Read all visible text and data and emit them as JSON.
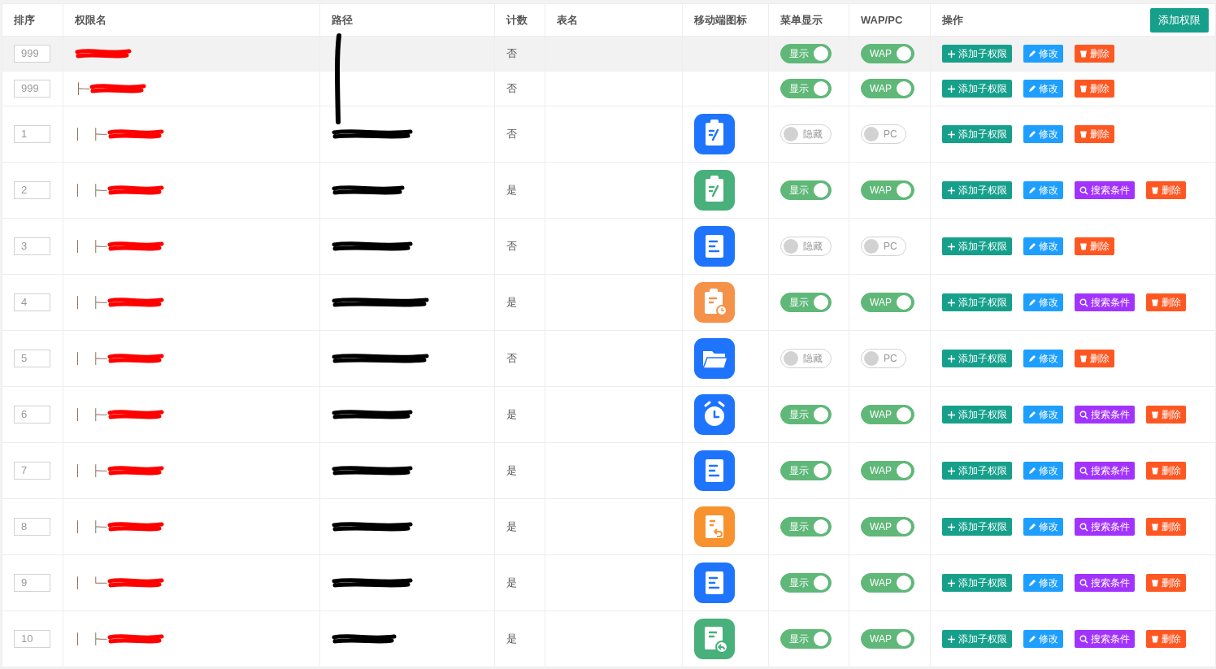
{
  "table": {
    "columns": [
      "排序",
      "权限名",
      "路径",
      "计数",
      "表名",
      "移动端图标",
      "菜单显示",
      "WAP/PC",
      "操作"
    ],
    "add_button": "添加权限",
    "rows": [
      {
        "sort": "999",
        "prefix": "",
        "highlighted": true,
        "name": {
          "kind": "redacted"
        },
        "count": "否",
        "icon": null,
        "menu": {
          "on": true,
          "label": "显示"
        },
        "platform": {
          "on": true,
          "label": "WAP"
        },
        "actions": [
          {
            "kind": "add",
            "label": "添加子权限"
          },
          {
            "kind": "edit",
            "label": "修改"
          },
          {
            "kind": "delete",
            "label": "删除"
          }
        ]
      },
      {
        "sort": "999",
        "prefix": "├─",
        "highlighted": false,
        "name": {
          "kind": "redacted"
        },
        "count": "否",
        "icon": null,
        "menu": {
          "on": true,
          "label": "显示"
        },
        "platform": {
          "on": true,
          "label": "WAP"
        },
        "actions": [
          {
            "kind": "add",
            "label": "添加子权限"
          },
          {
            "kind": "edit",
            "label": "修改"
          },
          {
            "kind": "delete",
            "label": "删除"
          }
        ]
      },
      {
        "sort": "1",
        "prefix": "│　├─",
        "highlighted": false,
        "name": {
          "kind": "redacted"
        },
        "path": {
          "kind": "redacted"
        },
        "count": "否",
        "icon": {
          "kind": "clipboard",
          "color": "#1e74fd"
        },
        "menu": {
          "on": false,
          "label": "隐藏"
        },
        "platform": {
          "on": false,
          "label": "PC"
        },
        "actions": [
          {
            "kind": "add",
            "label": "添加子权限"
          },
          {
            "kind": "edit",
            "label": "修改"
          },
          {
            "kind": "delete",
            "label": "删除"
          }
        ]
      },
      {
        "sort": "2",
        "prefix": "│　├─",
        "highlighted": false,
        "name": {
          "kind": "redacted"
        },
        "path": {
          "kind": "redacted"
        },
        "count": "是",
        "icon": {
          "kind": "clipboard",
          "color": "#48b07a"
        },
        "menu": {
          "on": true,
          "label": "显示"
        },
        "platform": {
          "on": true,
          "label": "WAP"
        },
        "actions": [
          {
            "kind": "add",
            "label": "添加子权限"
          },
          {
            "kind": "edit",
            "label": "修改"
          },
          {
            "kind": "search",
            "label": "搜索条件"
          },
          {
            "kind": "delete",
            "label": "删除"
          }
        ]
      },
      {
        "sort": "3",
        "prefix": "│　├─",
        "highlighted": false,
        "name": {
          "kind": "redacted"
        },
        "path": {
          "kind": "redacted"
        },
        "count": "否",
        "icon": {
          "kind": "document",
          "color": "#1e74fd"
        },
        "menu": {
          "on": false,
          "label": "隐藏"
        },
        "platform": {
          "on": false,
          "label": "PC"
        },
        "actions": [
          {
            "kind": "add",
            "label": "添加子权限"
          },
          {
            "kind": "edit",
            "label": "修改"
          },
          {
            "kind": "delete",
            "label": "删除"
          }
        ]
      },
      {
        "sort": "4",
        "prefix": "│　├─",
        "highlighted": false,
        "name": {
          "kind": "redacted"
        },
        "path": {
          "kind": "redacted"
        },
        "count": "是",
        "icon": {
          "kind": "clock-clipboard",
          "color": "#f5924a"
        },
        "menu": {
          "on": true,
          "label": "显示"
        },
        "platform": {
          "on": true,
          "label": "WAP"
        },
        "actions": [
          {
            "kind": "add",
            "label": "添加子权限"
          },
          {
            "kind": "edit",
            "label": "修改"
          },
          {
            "kind": "search",
            "label": "搜索条件"
          },
          {
            "kind": "delete",
            "label": "删除"
          }
        ]
      },
      {
        "sort": "5",
        "prefix": "│　├─",
        "highlighted": false,
        "name": {
          "kind": "redacted"
        },
        "path": {
          "kind": "redacted"
        },
        "count": "否",
        "icon": {
          "kind": "folder",
          "color": "#1e74fd"
        },
        "menu": {
          "on": false,
          "label": "隐藏"
        },
        "platform": {
          "on": false,
          "label": "PC"
        },
        "actions": [
          {
            "kind": "add",
            "label": "添加子权限"
          },
          {
            "kind": "edit",
            "label": "修改"
          },
          {
            "kind": "delete",
            "label": "删除"
          }
        ]
      },
      {
        "sort": "6",
        "prefix": "│　├─",
        "highlighted": false,
        "name": {
          "kind": "redacted"
        },
        "path": {
          "kind": "redacted"
        },
        "count": "是",
        "icon": {
          "kind": "alarm",
          "color": "#1e74fd"
        },
        "menu": {
          "on": true,
          "label": "显示"
        },
        "platform": {
          "on": true,
          "label": "WAP"
        },
        "actions": [
          {
            "kind": "add",
            "label": "添加子权限"
          },
          {
            "kind": "edit",
            "label": "修改"
          },
          {
            "kind": "search",
            "label": "搜索条件"
          },
          {
            "kind": "delete",
            "label": "删除"
          }
        ]
      },
      {
        "sort": "7",
        "prefix": "│　├─",
        "highlighted": false,
        "name": {
          "kind": "redacted"
        },
        "path": {
          "kind": "redacted"
        },
        "count": "是",
        "icon": {
          "kind": "document",
          "color": "#1e74fd"
        },
        "menu": {
          "on": true,
          "label": "显示"
        },
        "platform": {
          "on": true,
          "label": "WAP"
        },
        "actions": [
          {
            "kind": "add",
            "label": "添加子权限"
          },
          {
            "kind": "edit",
            "label": "修改"
          },
          {
            "kind": "search",
            "label": "搜索条件"
          },
          {
            "kind": "delete",
            "label": "删除"
          }
        ]
      },
      {
        "sort": "8",
        "prefix": "│　├─",
        "highlighted": false,
        "name": {
          "kind": "redacted"
        },
        "path": {
          "kind": "redacted"
        },
        "count": "是",
        "icon": {
          "kind": "return-document",
          "color": "#f7922e"
        },
        "menu": {
          "on": true,
          "label": "显示"
        },
        "platform": {
          "on": true,
          "label": "WAP"
        },
        "actions": [
          {
            "kind": "add",
            "label": "添加子权限"
          },
          {
            "kind": "edit",
            "label": "修改"
          },
          {
            "kind": "search",
            "label": "搜索条件"
          },
          {
            "kind": "delete",
            "label": "删除"
          }
        ]
      },
      {
        "sort": "9",
        "prefix": "│　└─",
        "highlighted": false,
        "name": {
          "kind": "redacted"
        },
        "path": {
          "kind": "redacted"
        },
        "count": "是",
        "icon": {
          "kind": "document",
          "color": "#1e74fd"
        },
        "menu": {
          "on": true,
          "label": "显示"
        },
        "platform": {
          "on": true,
          "label": "WAP"
        },
        "actions": [
          {
            "kind": "add",
            "label": "添加子权限"
          },
          {
            "kind": "edit",
            "label": "修改"
          },
          {
            "kind": "search",
            "label": "搜索条件"
          },
          {
            "kind": "delete",
            "label": "删除"
          }
        ]
      },
      {
        "sort": "10",
        "prefix": "│　├─",
        "highlighted": false,
        "name": {
          "kind": "redacted"
        },
        "path": {
          "kind": "redacted"
        },
        "count": "是",
        "icon": {
          "kind": "reply-document",
          "color": "#48b07a"
        },
        "menu": {
          "on": true,
          "label": "显示"
        },
        "platform": {
          "on": true,
          "label": "WAP"
        },
        "actions": [
          {
            "kind": "add",
            "label": "添加子权限"
          },
          {
            "kind": "edit",
            "label": "修改"
          },
          {
            "kind": "search",
            "label": "搜索条件"
          },
          {
            "kind": "delete",
            "label": "删除"
          }
        ]
      }
    ]
  }
}
